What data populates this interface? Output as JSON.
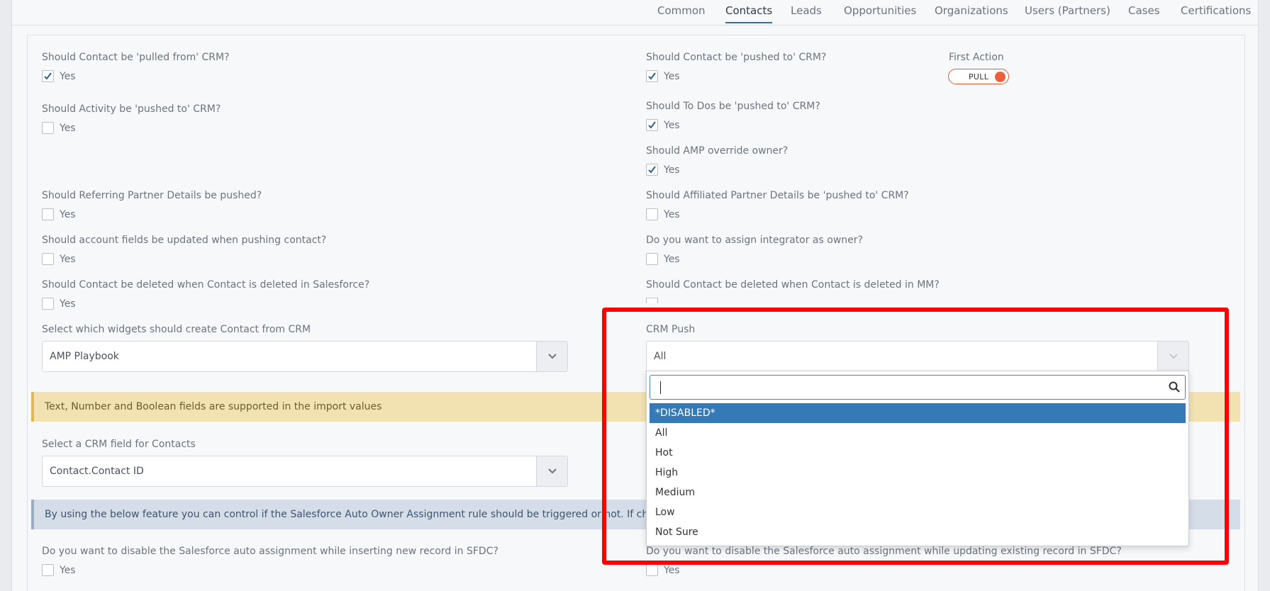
{
  "tabs": [
    "Common",
    "Contacts",
    "Leads",
    "Opportunities",
    "Organizations",
    "Users (Partners)",
    "Cases",
    "Certifications"
  ],
  "active_tab": "Contacts",
  "yes_label": "Yes",
  "questions": {
    "pulled_from": "Should Contact be 'pulled from' CRM?",
    "activity_pushed": "Should Activity be 'pushed to' CRM?",
    "referring_partner": "Should Referring Partner Details be pushed?",
    "account_fields": "Should account fields be updated when pushing contact?",
    "deleted_sf": "Should Contact be deleted when Contact is deleted in Salesforce?",
    "pushed_to": "Should Contact be 'pushed to' CRM?",
    "todos_pushed": "Should To Dos be 'pushed to' CRM?",
    "amp_override": "Should AMP override owner?",
    "affiliated_partner": "Should Affiliated Partner Details be 'pushed to' CRM?",
    "integrator_owner": "Do you want to assign integrator as owner?",
    "deleted_mm": "Should Contact be deleted when Contact is deleted in MM?",
    "disable_insert": "Do you want to disable the Salesforce auto assignment while inserting new record in SFDC?",
    "disable_update": "Do you want to disable the Salesforce auto assignment while updating existing record in SFDC?"
  },
  "first_action": {
    "label": "First Action",
    "value": "PULL"
  },
  "widgets_select": {
    "label": "Select which widgets should create Contact from CRM",
    "value": "AMP Playbook"
  },
  "crm_push": {
    "label": "CRM Push",
    "value": "All"
  },
  "import_banner": "Text, Number and Boolean fields are supported in the import values",
  "crm_field_select": {
    "label": "Select a CRM field for Contacts",
    "value": "Contact.Contact ID"
  },
  "assignment_banner": "By using the below feature you can control if the Salesforce Auto Owner Assignment rule should be triggered or not. If checked, the Sa",
  "dropdown": {
    "search_value": "",
    "options": [
      "*DISABLED*",
      "All",
      "Hot",
      "High",
      "Medium",
      "Low",
      "Not Sure"
    ],
    "highlighted": "*DISABLED*"
  },
  "colors": {
    "accent": "#337ab7",
    "toggle": "#e8623b",
    "highlight_box": "#ff0000"
  }
}
